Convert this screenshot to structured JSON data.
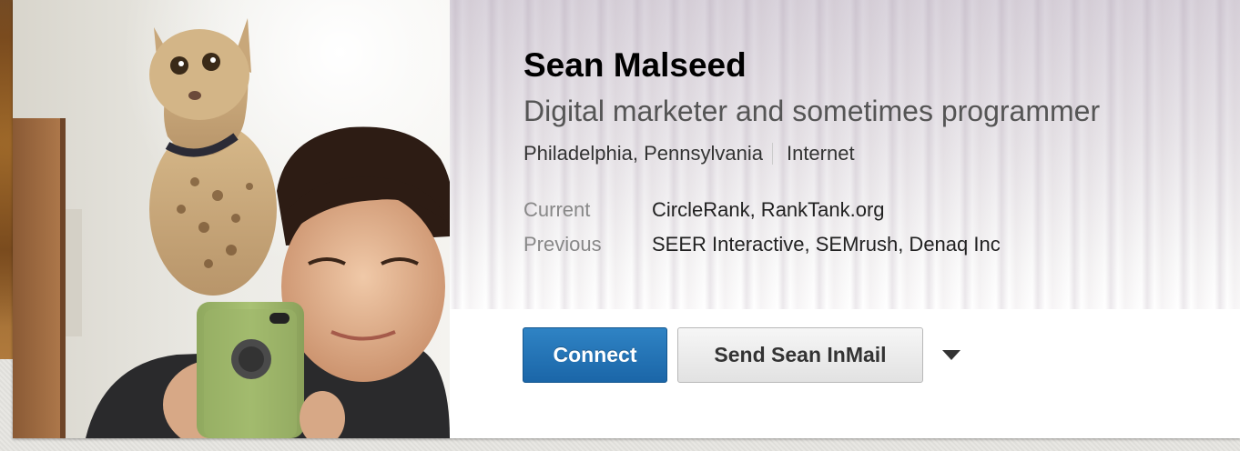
{
  "profile": {
    "name": "Sean Malseed",
    "headline": "Digital marketer and sometimes programmer",
    "location": "Philadelphia, Pennsylvania",
    "industry": "Internet",
    "positions": [
      {
        "label": "Current",
        "value": "CircleRank, RankTank.org"
      },
      {
        "label": "Previous",
        "value": "SEER Interactive, SEMrush, Denaq Inc"
      }
    ]
  },
  "actions": {
    "connect_label": "Connect",
    "inmail_label": "Send Sean InMail",
    "more_icon": "caret-down-icon"
  },
  "colors": {
    "connect_button": "#1b66a8",
    "secondary_button": "#e8e8e8",
    "name_text": "#000000",
    "headline_text": "#555555",
    "label_text": "#888888"
  }
}
